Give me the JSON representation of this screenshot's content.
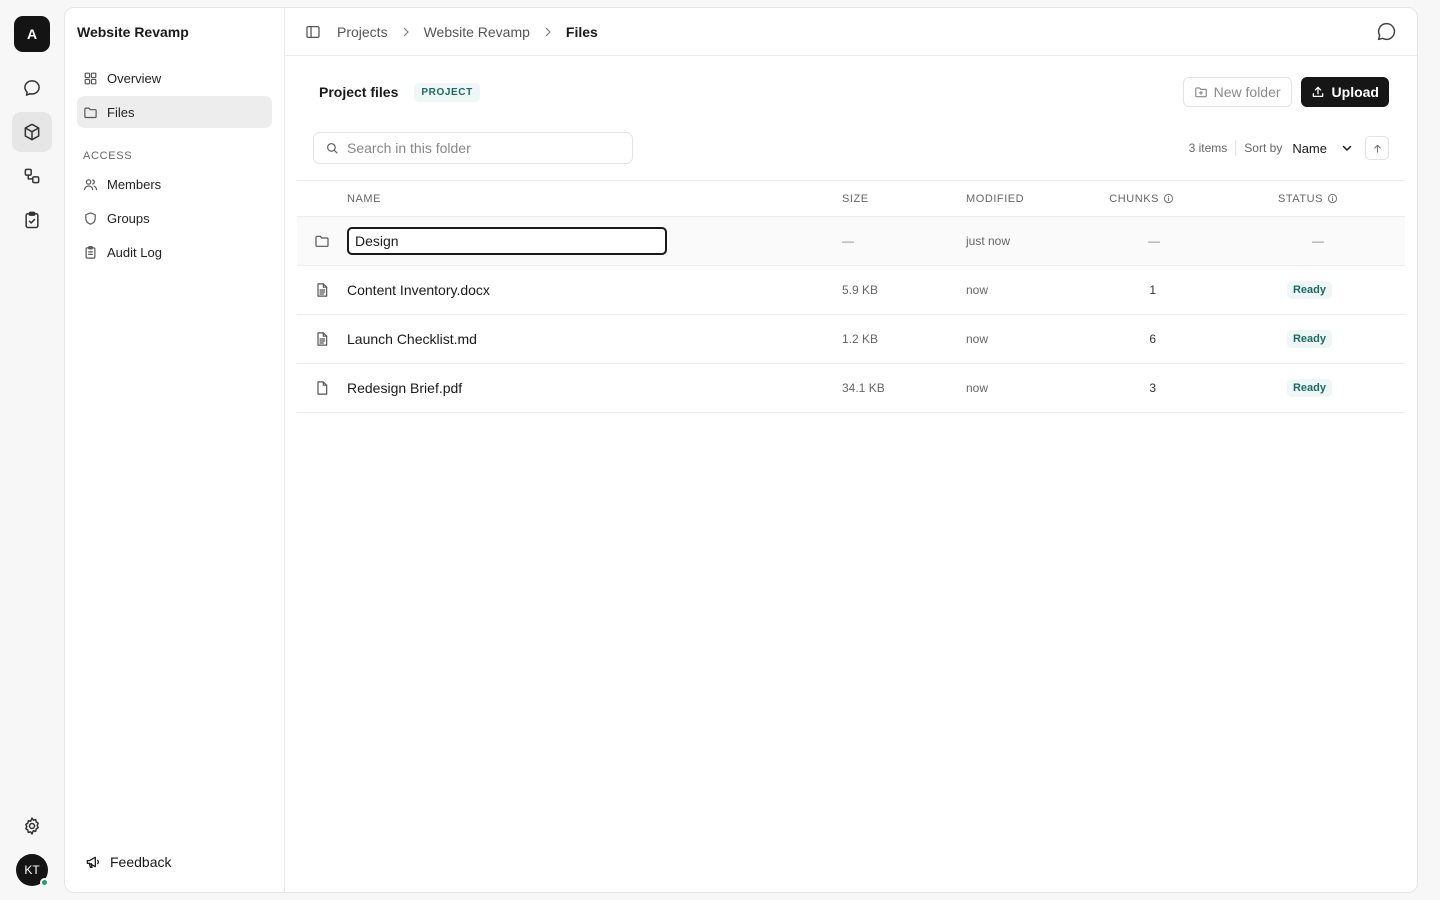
{
  "rail": {
    "org_initial": "A",
    "user_initials": "KT"
  },
  "sidebar": {
    "project_name": "Website Revamp",
    "nav": [
      {
        "label": "Overview",
        "icon": "grid-icon"
      },
      {
        "label": "Files",
        "icon": "folder-icon"
      }
    ],
    "access_label": "ACCESS",
    "access": [
      {
        "label": "Members",
        "icon": "users-icon"
      },
      {
        "label": "Groups",
        "icon": "shield-icon"
      },
      {
        "label": "Audit Log",
        "icon": "clipboard-icon"
      }
    ],
    "feedback_label": "Feedback"
  },
  "breadcrumb": {
    "items": [
      "Projects",
      "Website Revamp"
    ],
    "current": "Files"
  },
  "header": {
    "title": "Project files",
    "badge": "PROJECT",
    "new_folder_label": "New folder",
    "upload_label": "Upload"
  },
  "toolbar": {
    "search_placeholder": "Search in this folder",
    "item_count": "3 items",
    "sort_by_label": "Sort by",
    "sort_value": "Name"
  },
  "table": {
    "columns": {
      "name": "NAME",
      "size": "SIZE",
      "modified": "MODIFIED",
      "chunks": "CHUNKS",
      "status": "STATUS"
    },
    "rows": [
      {
        "type": "folder",
        "name": "Design",
        "size": "—",
        "modified": "just now",
        "chunks": "—",
        "status": "—"
      },
      {
        "type": "file",
        "name": "Content Inventory.docx",
        "size": "5.9 KB",
        "modified": "now",
        "chunks": "1",
        "status": "Ready"
      },
      {
        "type": "file",
        "name": "Launch Checklist.md",
        "size": "1.2 KB",
        "modified": "now",
        "chunks": "6",
        "status": "Ready"
      },
      {
        "type": "file",
        "name": "Redesign Brief.pdf",
        "size": "34.1 KB",
        "modified": "now",
        "chunks": "3",
        "status": "Ready"
      }
    ]
  },
  "colors": {
    "accent": "#161616",
    "ready_text": "#1b6b63",
    "ready_bg": "#eef7f5",
    "presence": "#1f9e77"
  }
}
